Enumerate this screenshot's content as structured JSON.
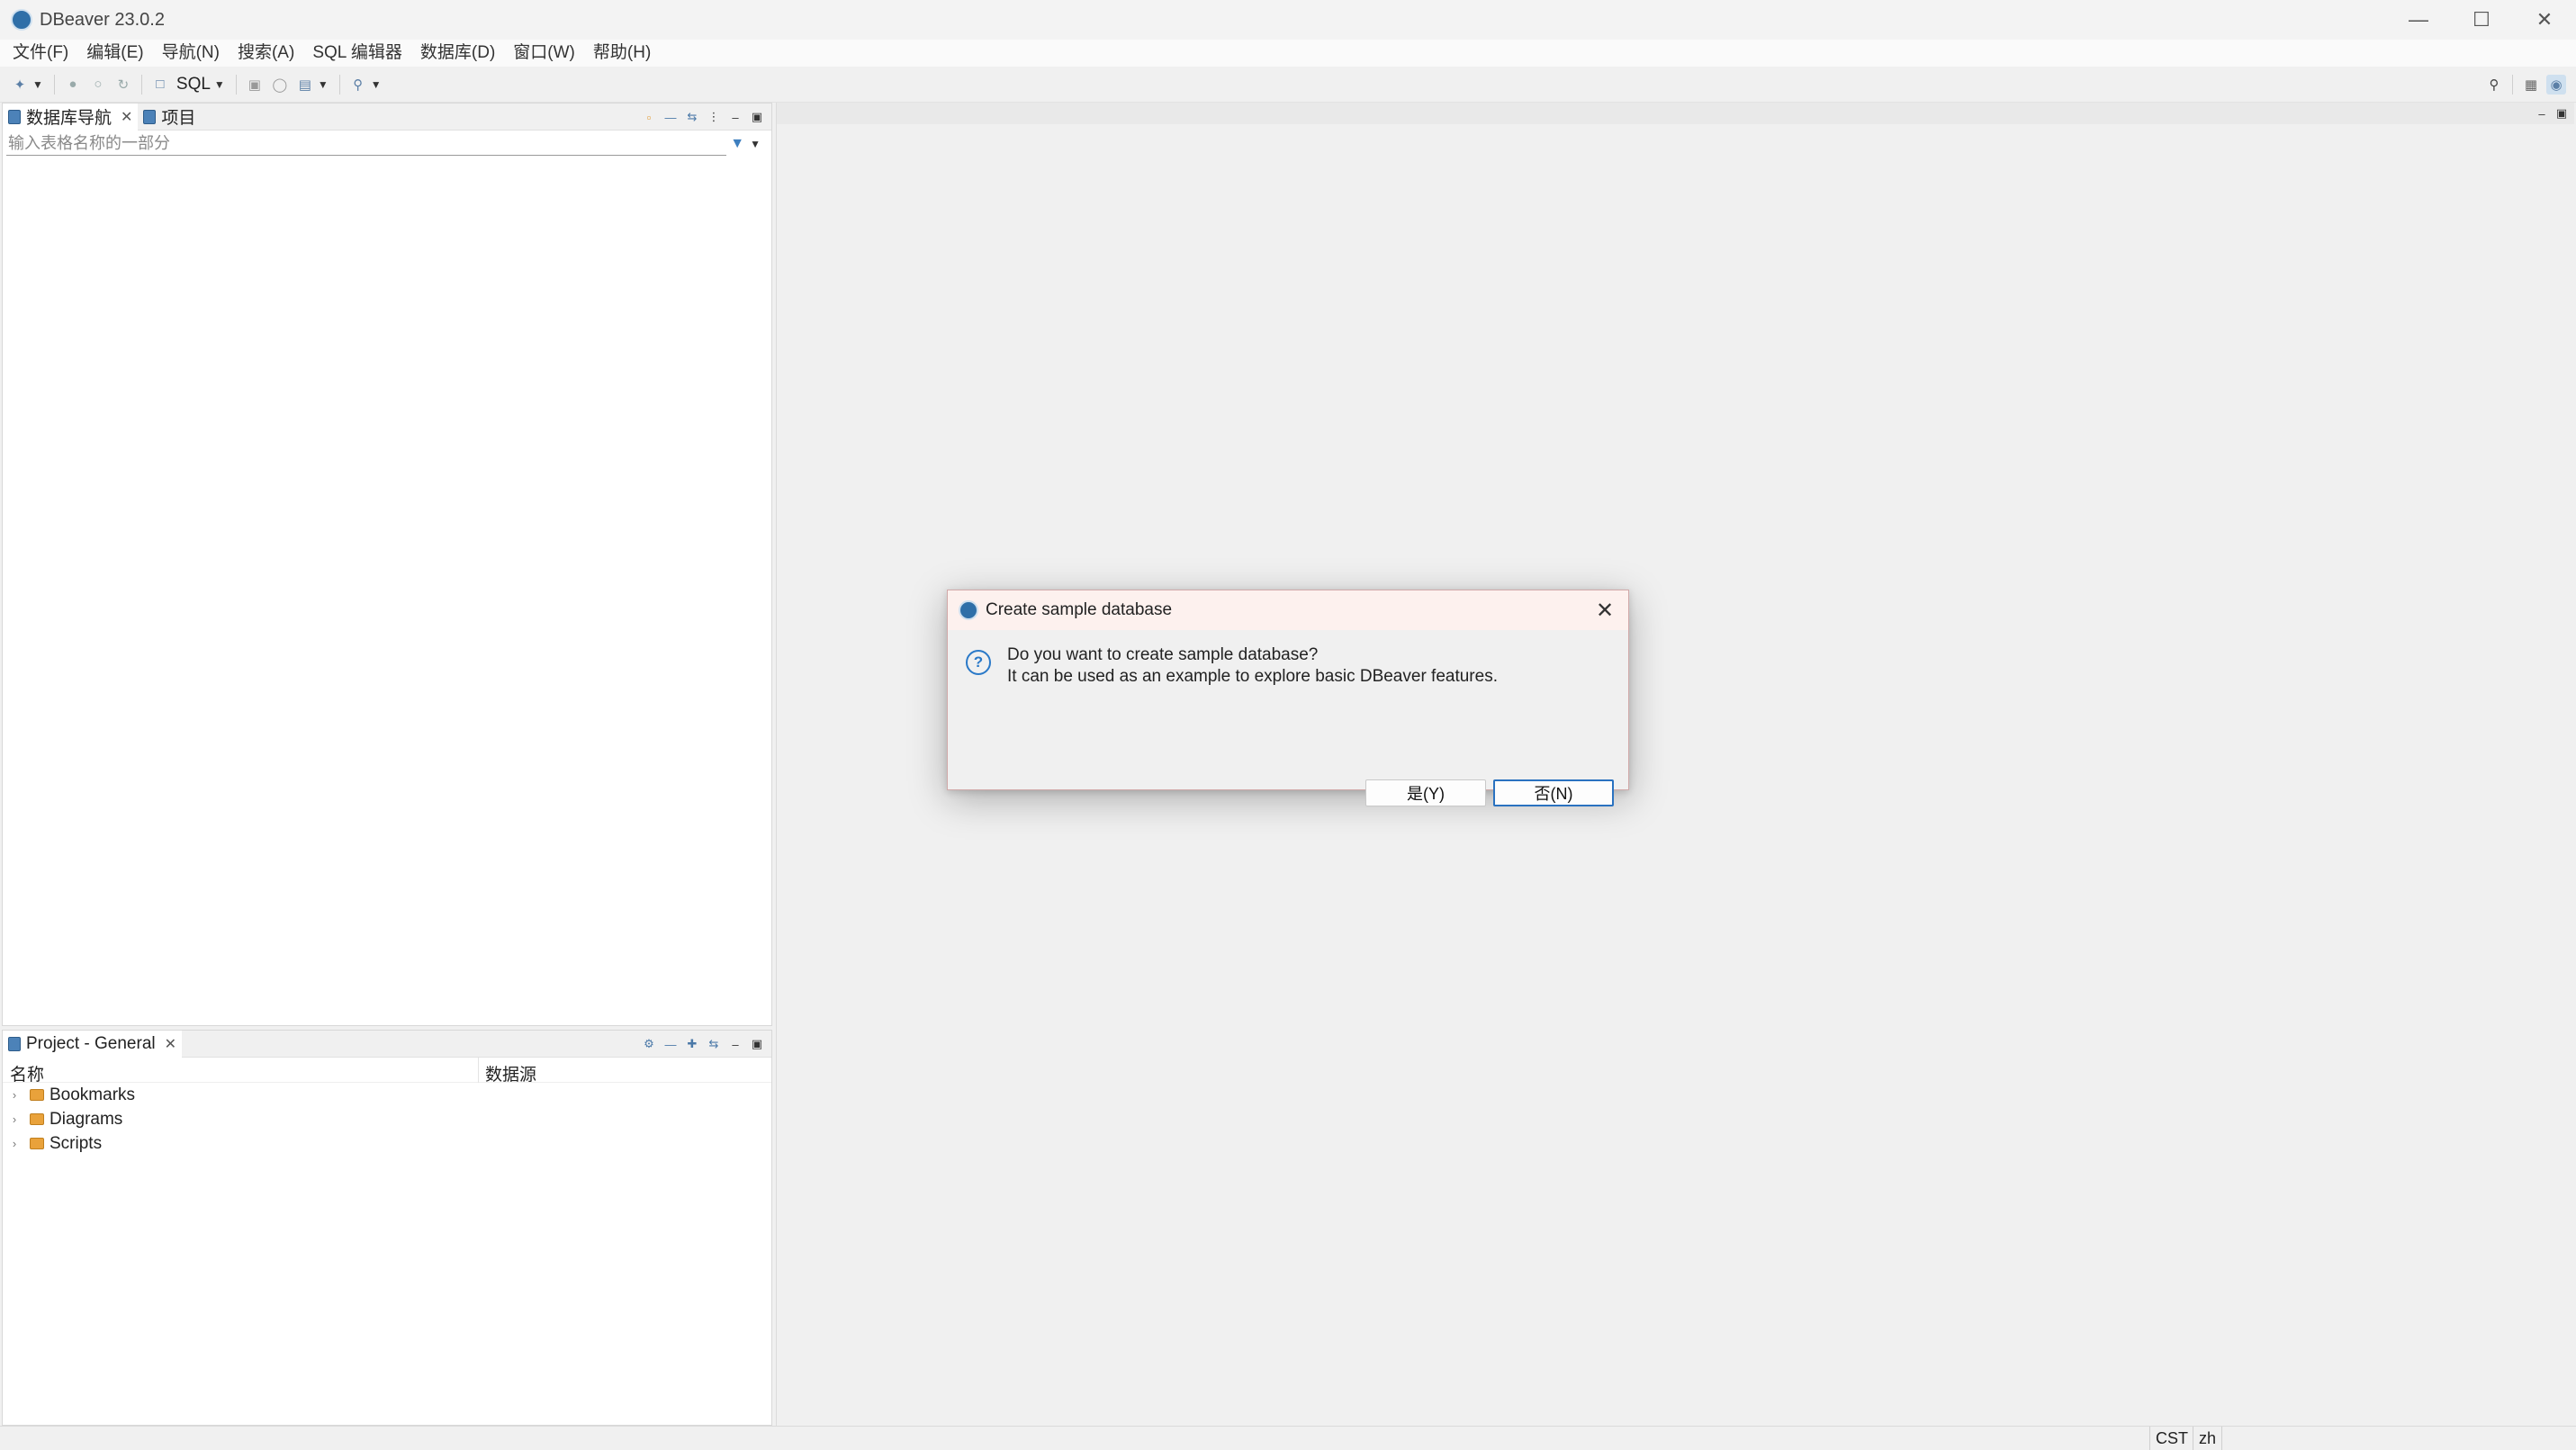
{
  "window": {
    "title": "DBeaver 23.0.2",
    "app_icon": "dbeaver-logo-icon",
    "controls": [
      "minimize-icon",
      "maximize-icon",
      "close-icon"
    ]
  },
  "menubar": {
    "items": [
      "文件(F)",
      "编辑(E)",
      "导航(N)",
      "搜索(A)",
      "SQL 编辑器",
      "数据库(D)",
      "窗口(W)",
      "帮助(H)"
    ]
  },
  "toolbar": {
    "sql_label": "SQL",
    "icons": [
      "new-connection-icon",
      "connect-icon",
      "disconnect-icon",
      "invalidate-icon",
      "sql-editor-icon",
      "lock-icon",
      "transaction-icon",
      "commit-icon",
      "search-icon"
    ],
    "right_icons": [
      "search-icon",
      "perspective-icon",
      "dbeaver-perspective-icon"
    ]
  },
  "navigator": {
    "tabs": [
      {
        "label": "数据库导航",
        "closable": true
      },
      {
        "label": "项目",
        "closable": false
      }
    ],
    "filter_placeholder": "输入表格名称的一部分"
  },
  "project": {
    "tab_label": "Project - General",
    "columns": [
      "名称",
      "数据源"
    ],
    "items": [
      "Bookmarks",
      "Diagrams",
      "Scripts"
    ]
  },
  "statusbar": {
    "timezone": "CST",
    "locale": "zh"
  },
  "dialog": {
    "title": "Create sample database",
    "line1": "Do you want to create sample database?",
    "line2": "It can be used as an example to explore basic DBeaver features.",
    "yes_label": "是(Y)",
    "no_label": "否(N)",
    "default_button": "no",
    "icon": "question-icon"
  },
  "colors": {
    "accent": "#2a72c0",
    "folder": "#e9a23b",
    "dialog_titlebar": "#fdf1ee"
  }
}
